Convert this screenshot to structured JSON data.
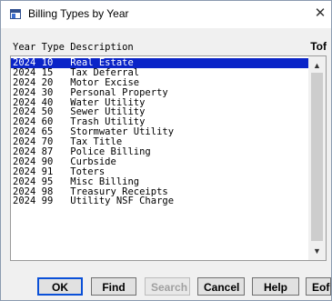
{
  "window": {
    "title": "Billing Types by Year"
  },
  "header": {
    "columns": "Year Type Description",
    "tof_label": "Tof"
  },
  "rows": [
    {
      "year": "2024",
      "type": "10",
      "description": "Real Estate",
      "selected": true
    },
    {
      "year": "2024",
      "type": "15",
      "description": "Tax Deferral"
    },
    {
      "year": "2024",
      "type": "20",
      "description": "Motor Excise"
    },
    {
      "year": "2024",
      "type": "30",
      "description": "Personal Property"
    },
    {
      "year": "2024",
      "type": "40",
      "description": "Water Utility"
    },
    {
      "year": "2024",
      "type": "50",
      "description": "Sewer Utility"
    },
    {
      "year": "2024",
      "type": "60",
      "description": "Trash Utility"
    },
    {
      "year": "2024",
      "type": "65",
      "description": "Stormwater Utility"
    },
    {
      "year": "2024",
      "type": "70",
      "description": "Tax Title"
    },
    {
      "year": "2024",
      "type": "87",
      "description": "Police Billing"
    },
    {
      "year": "2024",
      "type": "90",
      "description": "Curbside"
    },
    {
      "year": "2024",
      "type": "91",
      "description": "Toters"
    },
    {
      "year": "2024",
      "type": "95",
      "description": "Misc Billing"
    },
    {
      "year": "2024",
      "type": "98",
      "description": "Treasury Receipts"
    },
    {
      "year": "2024",
      "type": "99",
      "description": "Utility NSF Charge"
    }
  ],
  "buttons": {
    "ok": "OK",
    "find": "Find",
    "search": "Search",
    "cancel": "Cancel",
    "help": "Help",
    "eof": "Eof"
  },
  "icons": {
    "app": "window-app-icon",
    "close": "close-icon",
    "scroll_up": "chevron-up-icon",
    "scroll_down": "chevron-down-icon"
  },
  "colors": {
    "selection": "#0a24c8",
    "default_button_border": "#0a50d8"
  }
}
